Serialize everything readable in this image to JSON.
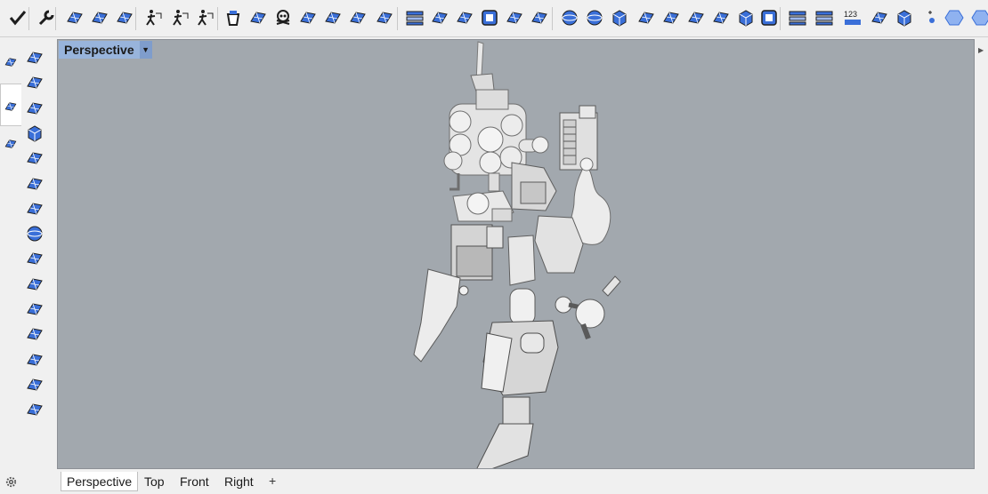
{
  "toolbar": {
    "icons": [
      "checkmark-icon",
      "wrench-icon",
      "grid-snap-icon",
      "material-sphere-icon",
      "grid-plane-icon",
      "walk-person-icon",
      "walk-person-2-icon",
      "walk-person-3-icon",
      "bucket-icon",
      "surface-edit-icon",
      "skull-icon",
      "hourglass-icon",
      "axis-icon",
      "surface-grid-icon",
      "angle-icon",
      "layers-icon",
      "surface-patch-icon",
      "move-points-icon",
      "rounded-square-icon",
      "rebuild-icon",
      "network-surface-icon",
      "ellipse-hat-icon",
      "sphere-icon",
      "cube-icon",
      "extrude-icon",
      "analyze-icon",
      "blend-icon",
      "split-icon",
      "cube-face-icon",
      "outline-square-icon",
      "dimension-icon",
      "dimension-2-icon",
      "number-text-icon",
      "boolean-icon",
      "solid-box-icon",
      "point-icon",
      "hexagon-icon",
      "hexagon-2-icon"
    ],
    "number_label": "123"
  },
  "sidebar": {
    "icons": [
      "polyline-icon",
      "rectangle-points-icon",
      "plane-icon",
      "box-icon",
      "cylinder-icon",
      "cone-icon",
      "truncated-cone-icon",
      "sphere-icon",
      "ellipsoid-icon",
      "torus-icon",
      "pipe-icon",
      "surface-patch-icon",
      "shrink-icon",
      "extrude-surface-icon",
      "cage-icon"
    ],
    "tab_icons": [
      "surface-tab-icon",
      "small-points-icon",
      "transform-tab-icon"
    ]
  },
  "viewport": {
    "title": "Perspective",
    "background": "#a2a8ae",
    "label_background": "#98b4dc"
  },
  "bottom_tabs": {
    "tabs": [
      "Perspective",
      "Top",
      "Front",
      "Right"
    ],
    "active": "Perspective",
    "add_label": "+"
  },
  "colors": {
    "icon_blue": "#3a6fd8",
    "icon_dark": "#1e1e1e",
    "model_light": "#e6e6e6",
    "model_shadow": "#6e6e6e"
  }
}
